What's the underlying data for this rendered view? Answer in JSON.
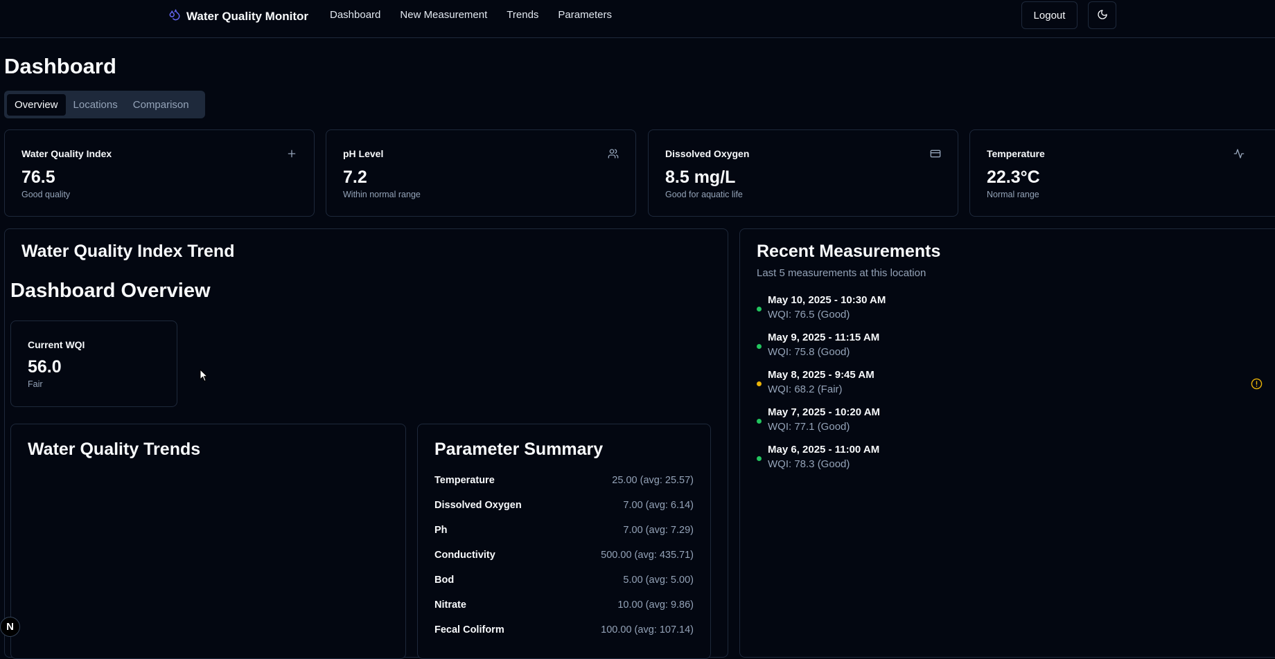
{
  "app": {
    "title": "Water Quality Monitor"
  },
  "nav": [
    "Dashboard",
    "New Measurement",
    "Trends",
    "Parameters"
  ],
  "header": {
    "logout_label": "Logout"
  },
  "page": {
    "title": "Dashboard"
  },
  "tabs": [
    {
      "label": "Overview",
      "active": true
    },
    {
      "label": "Locations",
      "active": false
    },
    {
      "label": "Comparison",
      "active": false
    }
  ],
  "stats": [
    {
      "title": "Water Quality Index",
      "value": "76.5",
      "sub": "Good quality",
      "icon": "plus-icon"
    },
    {
      "title": "pH Level",
      "value": "7.2",
      "sub": "Within normal range",
      "icon": "users-icon"
    },
    {
      "title": "Dissolved Oxygen",
      "value": "8.5 mg/L",
      "sub": "Good for aquatic life",
      "icon": "credit-card-icon"
    },
    {
      "title": "Temperature",
      "value": "22.3°C",
      "sub": "Normal range",
      "icon": "activity-icon"
    }
  ],
  "trend_panel": {
    "title": "Water Quality Index Trend",
    "overview_title": "Dashboard Overview",
    "current_wqi": {
      "label": "Current WQI",
      "value": "56.0",
      "status": "Fair"
    },
    "trends_title": "Water Quality Trends",
    "summary": {
      "title": "Parameter Summary",
      "rows": [
        {
          "name": "Temperature",
          "value": "25.00 (avg: 25.57)"
        },
        {
          "name": "Dissolved Oxygen",
          "value": "7.00 (avg: 6.14)"
        },
        {
          "name": "Ph",
          "value": "7.00 (avg: 7.29)"
        },
        {
          "name": "Conductivity",
          "value": "500.00 (avg: 435.71)"
        },
        {
          "name": "Bod",
          "value": "5.00 (avg: 5.00)"
        },
        {
          "name": "Nitrate",
          "value": "10.00 (avg: 9.86)"
        },
        {
          "name": "Fecal Coliform",
          "value": "100.00 (avg: 107.14)"
        }
      ]
    }
  },
  "recent": {
    "title": "Recent Measurements",
    "subtitle": "Last 5 measurements at this location",
    "items": [
      {
        "date": "May 10, 2025 - 10:30 AM",
        "wqi": "WQI: 76.5 (Good)",
        "color": "#22c55e"
      },
      {
        "date": "May 9, 2025 - 11:15 AM",
        "wqi": "WQI: 75.8 (Good)",
        "color": "#22c55e"
      },
      {
        "date": "May 8, 2025 - 9:45 AM",
        "wqi": "WQI: 68.2 (Fair)",
        "color": "#eab308"
      },
      {
        "date": "May 7, 2025 - 10:20 AM",
        "wqi": "WQI: 77.1 (Good)",
        "color": "#22c55e"
      },
      {
        "date": "May 6, 2025 - 11:00 AM",
        "wqi": "WQI: 78.3 (Good)",
        "color": "#22c55e"
      }
    ]
  },
  "colors": {
    "background": "#030711",
    "border": "#1e293b",
    "muted": "#94a3b8",
    "accent": "#6366f1",
    "warning": "#eab308"
  },
  "dev_badge": "N"
}
